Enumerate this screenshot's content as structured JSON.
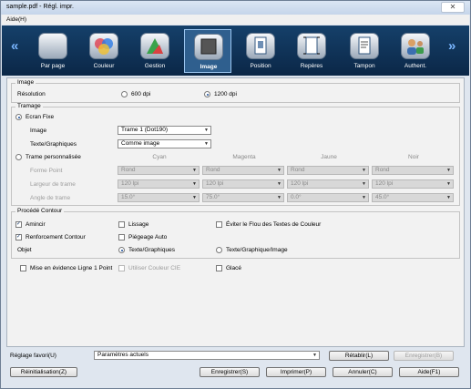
{
  "window": {
    "title": "sample.pdf - Régl. impr.",
    "close": "✕"
  },
  "menu": {
    "help": "Aide(H)"
  },
  "ribbon": {
    "prev": "«",
    "next": "»",
    "tabs": [
      {
        "label": "Par page",
        "icon": "pages-stack-icon"
      },
      {
        "label": "Couleur",
        "icon": "color-circles-icon"
      },
      {
        "label": "Gestion",
        "icon": "management-icon"
      },
      {
        "label": "Image",
        "icon": "image-icon",
        "selected": true
      },
      {
        "label": "Position",
        "icon": "position-icon"
      },
      {
        "label": "Repères",
        "icon": "marks-icon"
      },
      {
        "label": "Tampon",
        "icon": "stamp-icon"
      },
      {
        "label": "Authent.",
        "icon": "authentication-icon"
      }
    ]
  },
  "image_group": {
    "title": "Image",
    "resolution_label": "Résolution",
    "opt600": "600 dpi",
    "opt1200": "1200 dpi",
    "selected": "1200 dpi"
  },
  "screening": {
    "title": "Tramage",
    "fixed_label": "Ecran Fixe",
    "image_label": "Image",
    "image_value": "Trame 1 (Dot190)",
    "text_label": "Texte/Graphiques",
    "text_value": "Comme image",
    "custom_label": "Trame personnalisée",
    "columns": [
      "Cyan",
      "Magenta",
      "Jaune",
      "Noir"
    ],
    "rows": [
      {
        "label": "Forme Point",
        "values": [
          "Rond",
          "Rond",
          "Rond",
          "Rond"
        ]
      },
      {
        "label": "Largeur de trame",
        "values": [
          "120 lpi",
          "120 lpi",
          "120 lpi",
          "120 lpi"
        ]
      },
      {
        "label": "Angle de trame",
        "values": [
          "15.0°",
          "75.0°",
          "0.0°",
          "45.0°"
        ]
      }
    ]
  },
  "contour": {
    "title": "Procédé Contour",
    "smoothing": "Amincir",
    "lissage": "Lissage",
    "eviter": "Éviter le Flou des Textes de Couleur",
    "renfort": "Renforcement Contour",
    "piegeage": "Piégeage Auto",
    "objet_label": "Objet",
    "obj_text": "Texte/Graphiques",
    "obj_text_image": "Texte/Graphique/Image"
  },
  "misc": {
    "highlight": "Mise en évidence Ligne 1 Point",
    "cie": "Utiliser Couleur CIE",
    "glace": "Glacé"
  },
  "footer": {
    "favorite_label": "Réglage favori(U)",
    "favorite_value": "Paramètres actuels",
    "restore": "Rétablir(L)",
    "save_fav": "Enregistrer(B)",
    "reset": "Réinitialisation(Z)",
    "save": "Enregistrer(S)",
    "print": "Imprimer(P)",
    "cancel": "Annuler(C)",
    "help": "Aide(F1)"
  }
}
